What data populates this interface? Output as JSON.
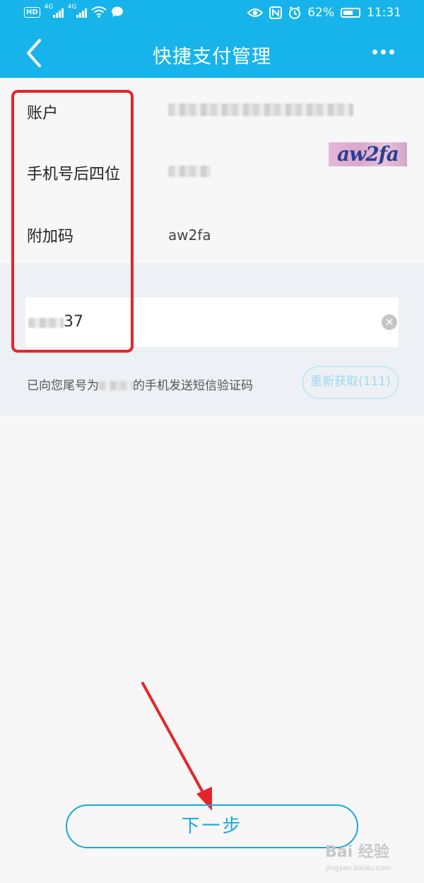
{
  "status_bar": {
    "hd": "HD",
    "network_1": "4G",
    "network_2": "4G",
    "battery": "62%",
    "time": "11:31"
  },
  "header": {
    "title": "快捷支付管理"
  },
  "info": {
    "account_label": "账户",
    "phone_label": "手机号后四位",
    "extra_code_label": "附加码",
    "extra_code_value": "aw2fa",
    "captcha_text": "aw2fa"
  },
  "code": {
    "value_suffix": "37",
    "sms_prefix": "已向您尾号为",
    "sms_suffix": "的手机发送短信验证码",
    "resend_label": "重新获取(111)"
  },
  "footer": {
    "next_label": "下一步"
  },
  "watermark": {
    "top": "Bai 经验",
    "bottom": "jingyan.baidu.com"
  },
  "colors": {
    "accent": "#16b4ea",
    "annotation": "#e8242a"
  }
}
